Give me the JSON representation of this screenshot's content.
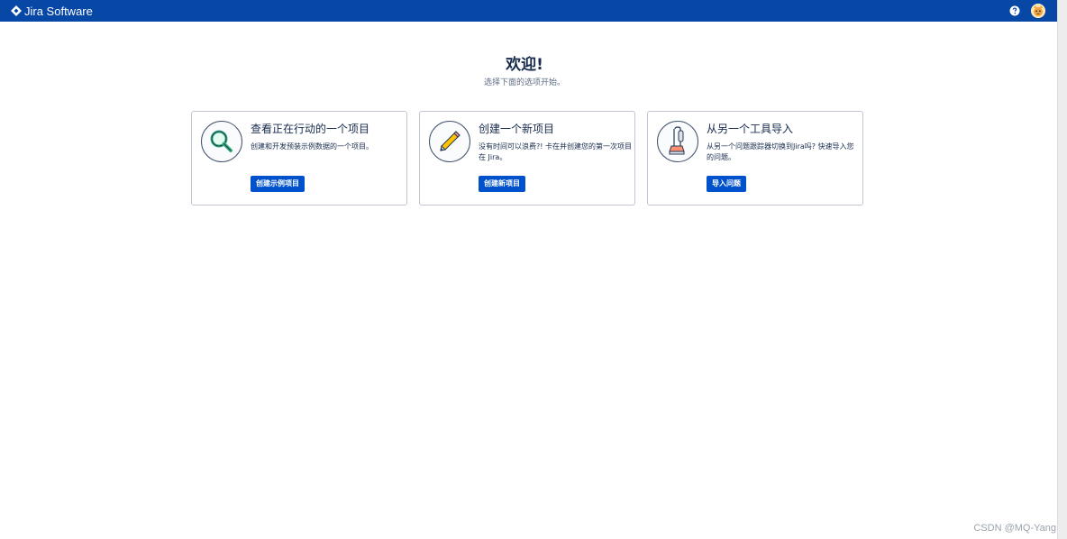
{
  "app": {
    "name": "Jira Software",
    "brand_color": "#0747a6",
    "primary_button_color": "#0052cc"
  },
  "topbar": {
    "help_icon": "help-icon",
    "avatar_icon": "user-avatar"
  },
  "welcome": {
    "title": "欢迎!",
    "subtitle": "选择下面的选项开始。"
  },
  "cards": [
    {
      "icon": "magnifier-icon",
      "title": "查看正在行动的一个项目",
      "description": "创建和开发预装示例数据的一个项目。",
      "button": "创建示例项目"
    },
    {
      "icon": "pencil-icon",
      "title": "创建一个新项目",
      "description": "没有时间可以浪费?! 卡在并创建您的第一次项目在 Jira。",
      "button": "创建新项目"
    },
    {
      "icon": "vacuum-icon",
      "title": "从另一个工具导入",
      "description": "从另一个问题跟踪器切换到Jira吗? 快速导入您的问题。",
      "button": "导入问题"
    }
  ],
  "watermark": "CSDN @MQ-Yang"
}
